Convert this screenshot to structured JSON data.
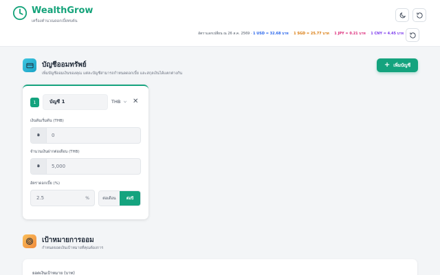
{
  "header": {
    "brand": "WealthGrow",
    "tagline": "เครื่องคำนวณดอกเบี้ยทบต้น",
    "rates_prefix": "อัตราแลกเปลี่ยน ณ 26 ส.ค. 2569 · ",
    "rates": [
      {
        "label": "1 USD = 32.68 บาท",
        "color": "#2563eb"
      },
      {
        "label": "1 SGD = 25.77 บาท",
        "color": "#d97706"
      },
      {
        "label": "1 JPY = 0.21 บาท",
        "color": "#db2777"
      },
      {
        "label": "1 CNY = 4.45 บาท",
        "color": "#7c3aed"
      }
    ]
  },
  "accounts_section": {
    "title": "บัญชีออมทรัพย์",
    "subtitle": "เพิ่มบัญชีออมเงินของคุณ แต่ละบัญชีสามารถกำหนดดอกเบี้ย และสกุลเงินได้แตกต่างกัน",
    "add_button": "เพิ่มบัญชี",
    "icon": "card-icon",
    "color": "#2db8d6"
  },
  "account": {
    "number": "1",
    "name": "บัญชี 1",
    "currency": "THB",
    "initial_label": "เงินต้นเริ่มต้น (THB)",
    "initial_prefix": "฿",
    "initial_value": "0",
    "monthly_label": "จำนวนเงินฝากต่อเดือน (THB)",
    "monthly_prefix": "฿",
    "monthly_value": "5,000",
    "rate_label": "อัตราดอกเบี้ย (%)",
    "rate_value": "2.5",
    "rate_unit": "%",
    "period_month": "ต่อเดือน",
    "period_year": "ต่อปี",
    "period_selected": "ต่อปี"
  },
  "goal_section": {
    "title": "เป้าหมายการออม",
    "subtitle": "กำหนดยอดเงินเป้าหมายที่คุณต้องการ",
    "icon": "target-icon",
    "goal_label": "ยอดเงินเป้าหมาย (บาท)"
  },
  "colors": {
    "accent": "#14a37e"
  }
}
